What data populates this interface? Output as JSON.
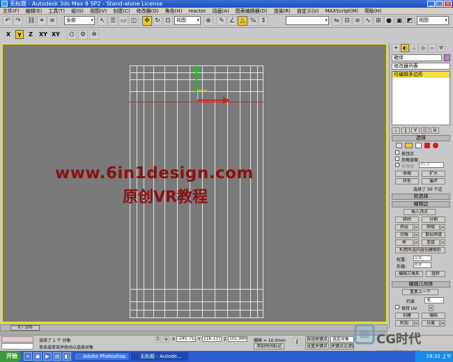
{
  "window": {
    "title": "无标题 - Autodesk 3ds Max 8 SP2 - Stand-alone License",
    "controls": [
      "_",
      "□",
      "×"
    ]
  },
  "menu": [
    "文件(F)",
    "编辑(E)",
    "工具(T)",
    "组(G)",
    "视图(V)",
    "创建(C)",
    "修改器(O)",
    "角色(H)",
    "reactor",
    "动画(A)",
    "图表编辑器(D)",
    "渲染(R)",
    "自定义(U)",
    "MAXScript(M)",
    "帮助(H)"
  ],
  "toolbar": {
    "selection_filter": "全部",
    "ref_coord": "视图",
    "named_selection": "",
    "view_dropdown": "视图"
  },
  "axis_constraints": [
    "X",
    "Y",
    "Z",
    "XY",
    "XY"
  ],
  "viewport": {
    "label": "",
    "watermark_url": "www.6in1design.com",
    "watermark_text": "原创VR教程",
    "active_border_color": "#e8e020"
  },
  "command_panel": {
    "object_name": "箱体",
    "modifier_list": "修改器列表",
    "modifier_stack_item": "可编辑多边形",
    "selection_rollout": "选择",
    "by_vertex": "按顶点",
    "ignore_backfacing": "忽略背面",
    "by_angle": "按角度",
    "angle_value": "45.0",
    "shrink": "收缩",
    "grow": "扩大",
    "ring": "环形",
    "loop": "循环",
    "selected_count": "选择了 30 个边",
    "soft_selection_rollout": "软选择",
    "edit_edges_rollout": "编辑边",
    "insert_vertex": "插入顶点",
    "remove": "移除",
    "split": "分割",
    "extrude": "挤出",
    "weld": "焊接",
    "chamfer": "切角",
    "target_weld": "目标焊接",
    "bridge": "桥",
    "connect": "连接",
    "create_shape": "利用所选内容创建图形",
    "weight_label": "权重:",
    "weight_value": "1.0",
    "crease_label": "折缝:",
    "crease_value": "0.0",
    "edit_tri": "编辑三角形",
    "turn": "旋转",
    "edit_geometry_rollout": "编辑几何体",
    "repeat_last": "重复上一个",
    "constraints_label": "约束",
    "constraints_value": "无",
    "preserve_uv": "保持 UV",
    "create": "创建",
    "collapse": "塌陷",
    "attach": "附加",
    "detach": "分离"
  },
  "timeline": {
    "frame": "0 / 100"
  },
  "status": {
    "selection": "选择了 1 个 对象",
    "prompt": "单击或单击并拖动以选择对象",
    "x_value": "-245.753r",
    "y_value": "116.137m",
    "z_value": "101.99mm",
    "grid": "栅格 = 10.0mm",
    "add_time_tag": "添加时间标记",
    "auto_key": "自动关键点",
    "set_key": "设置关键点",
    "key_filter_label": "关键点过滤器...",
    "selected_set": "选定对象"
  },
  "taskbar": {
    "start": "开始",
    "tasks": [
      "Adobe Photoshop",
      "无标题 - Autode..."
    ],
    "time": "19:32 上午"
  },
  "logo": {
    "brand": "CG时代",
    "url": "www.cgtimes.com"
  }
}
